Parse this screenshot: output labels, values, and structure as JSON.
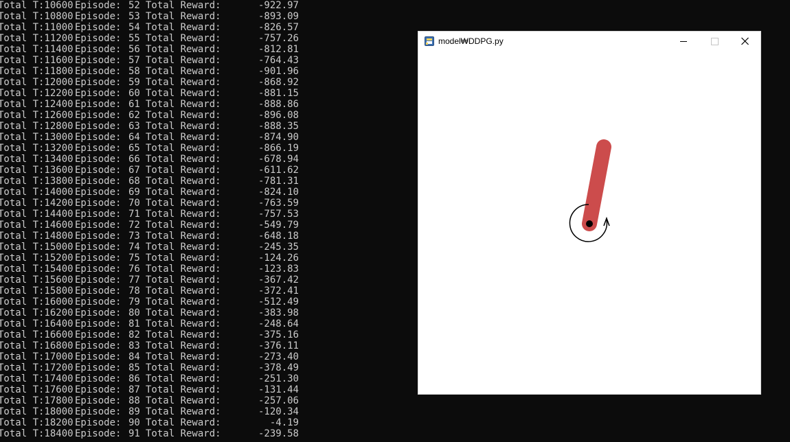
{
  "console": {
    "lines": [
      {
        "t": "Total T:10600",
        "ep_label": "Episode:",
        "ep": "52",
        "rw_label": "Total Reward:",
        "reward": "-922.97"
      },
      {
        "t": "Total T:10800",
        "ep_label": "Episode:",
        "ep": "53",
        "rw_label": "Total Reward:",
        "reward": "-893.09"
      },
      {
        "t": "Total T:11000",
        "ep_label": "Episode:",
        "ep": "54",
        "rw_label": "Total Reward:",
        "reward": "-826.57"
      },
      {
        "t": "Total T:11200",
        "ep_label": "Episode:",
        "ep": "55",
        "rw_label": "Total Reward:",
        "reward": "-757.26"
      },
      {
        "t": "Total T:11400",
        "ep_label": "Episode:",
        "ep": "56",
        "rw_label": "Total Reward:",
        "reward": "-812.81"
      },
      {
        "t": "Total T:11600",
        "ep_label": "Episode:",
        "ep": "57",
        "rw_label": "Total Reward:",
        "reward": "-764.43"
      },
      {
        "t": "Total T:11800",
        "ep_label": "Episode:",
        "ep": "58",
        "rw_label": "Total Reward:",
        "reward": "-901.96"
      },
      {
        "t": "Total T:12000",
        "ep_label": "Episode:",
        "ep": "59",
        "rw_label": "Total Reward:",
        "reward": "-868.92"
      },
      {
        "t": "Total T:12200",
        "ep_label": "Episode:",
        "ep": "60",
        "rw_label": "Total Reward:",
        "reward": "-881.15"
      },
      {
        "t": "Total T:12400",
        "ep_label": "Episode:",
        "ep": "61",
        "rw_label": "Total Reward:",
        "reward": "-888.86"
      },
      {
        "t": "Total T:12600",
        "ep_label": "Episode:",
        "ep": "62",
        "rw_label": "Total Reward:",
        "reward": "-896.08"
      },
      {
        "t": "Total T:12800",
        "ep_label": "Episode:",
        "ep": "63",
        "rw_label": "Total Reward:",
        "reward": "-888.35"
      },
      {
        "t": "Total T:13000",
        "ep_label": "Episode:",
        "ep": "64",
        "rw_label": "Total Reward:",
        "reward": "-874.90"
      },
      {
        "t": "Total T:13200",
        "ep_label": "Episode:",
        "ep": "65",
        "rw_label": "Total Reward:",
        "reward": "-866.19"
      },
      {
        "t": "Total T:13400",
        "ep_label": "Episode:",
        "ep": "66",
        "rw_label": "Total Reward:",
        "reward": "-678.94"
      },
      {
        "t": "Total T:13600",
        "ep_label": "Episode:",
        "ep": "67",
        "rw_label": "Total Reward:",
        "reward": "-611.62"
      },
      {
        "t": "Total T:13800",
        "ep_label": "Episode:",
        "ep": "68",
        "rw_label": "Total Reward:",
        "reward": "-781.31"
      },
      {
        "t": "Total T:14000",
        "ep_label": "Episode:",
        "ep": "69",
        "rw_label": "Total Reward:",
        "reward": "-824.10"
      },
      {
        "t": "Total T:14200",
        "ep_label": "Episode:",
        "ep": "70",
        "rw_label": "Total Reward:",
        "reward": "-763.59"
      },
      {
        "t": "Total T:14400",
        "ep_label": "Episode:",
        "ep": "71",
        "rw_label": "Total Reward:",
        "reward": "-757.53"
      },
      {
        "t": "Total T:14600",
        "ep_label": "Episode:",
        "ep": "72",
        "rw_label": "Total Reward:",
        "reward": "-549.79"
      },
      {
        "t": "Total T:14800",
        "ep_label": "Episode:",
        "ep": "73",
        "rw_label": "Total Reward:",
        "reward": "-648.18"
      },
      {
        "t": "Total T:15000",
        "ep_label": "Episode:",
        "ep": "74",
        "rw_label": "Total Reward:",
        "reward": "-245.35"
      },
      {
        "t": "Total T:15200",
        "ep_label": "Episode:",
        "ep": "75",
        "rw_label": "Total Reward:",
        "reward": "-124.26"
      },
      {
        "t": "Total T:15400",
        "ep_label": "Episode:",
        "ep": "76",
        "rw_label": "Total Reward:",
        "reward": "-123.83"
      },
      {
        "t": "Total T:15600",
        "ep_label": "Episode:",
        "ep": "77",
        "rw_label": "Total Reward:",
        "reward": "-367.42"
      },
      {
        "t": "Total T:15800",
        "ep_label": "Episode:",
        "ep": "78",
        "rw_label": "Total Reward:",
        "reward": "-372.41"
      },
      {
        "t": "Total T:16000",
        "ep_label": "Episode:",
        "ep": "79",
        "rw_label": "Total Reward:",
        "reward": "-512.49"
      },
      {
        "t": "Total T:16200",
        "ep_label": "Episode:",
        "ep": "80",
        "rw_label": "Total Reward:",
        "reward": "-383.98"
      },
      {
        "t": "Total T:16400",
        "ep_label": "Episode:",
        "ep": "81",
        "rw_label": "Total Reward:",
        "reward": "-248.64"
      },
      {
        "t": "Total T:16600",
        "ep_label": "Episode:",
        "ep": "82",
        "rw_label": "Total Reward:",
        "reward": "-375.16"
      },
      {
        "t": "Total T:16800",
        "ep_label": "Episode:",
        "ep": "83",
        "rw_label": "Total Reward:",
        "reward": "-376.11"
      },
      {
        "t": "Total T:17000",
        "ep_label": "Episode:",
        "ep": "84",
        "rw_label": "Total Reward:",
        "reward": "-273.40"
      },
      {
        "t": "Total T:17200",
        "ep_label": "Episode:",
        "ep": "85",
        "rw_label": "Total Reward:",
        "reward": "-378.49"
      },
      {
        "t": "Total T:17400",
        "ep_label": "Episode:",
        "ep": "86",
        "rw_label": "Total Reward:",
        "reward": "-251.30"
      },
      {
        "t": "Total T:17600",
        "ep_label": "Episode:",
        "ep": "87",
        "rw_label": "Total Reward:",
        "reward": "-131.44"
      },
      {
        "t": "Total T:17800",
        "ep_label": "Episode:",
        "ep": "88",
        "rw_label": "Total Reward:",
        "reward": "-257.06"
      },
      {
        "t": "Total T:18000",
        "ep_label": "Episode:",
        "ep": "89",
        "rw_label": "Total Reward:",
        "reward": "-120.34"
      },
      {
        "t": "Total T:18200",
        "ep_label": "Episode:",
        "ep": "90",
        "rw_label": "Total Reward:",
        "reward": "-4.19"
      },
      {
        "t": "Total T:18400",
        "ep_label": "Episode:",
        "ep": "91",
        "rw_label": "Total Reward:",
        "reward": "-239.58"
      }
    ]
  },
  "window": {
    "title": "model₩DDPG.py",
    "app_icon": "python-icon",
    "controls": {
      "minimize": "minimize-icon",
      "maximize": "maximize-icon",
      "close": "close-icon"
    }
  },
  "scene": {
    "pole_color": "#cc4c4c",
    "axle_color": "#000000",
    "torque_indicator": "curved-arrow-icon"
  }
}
